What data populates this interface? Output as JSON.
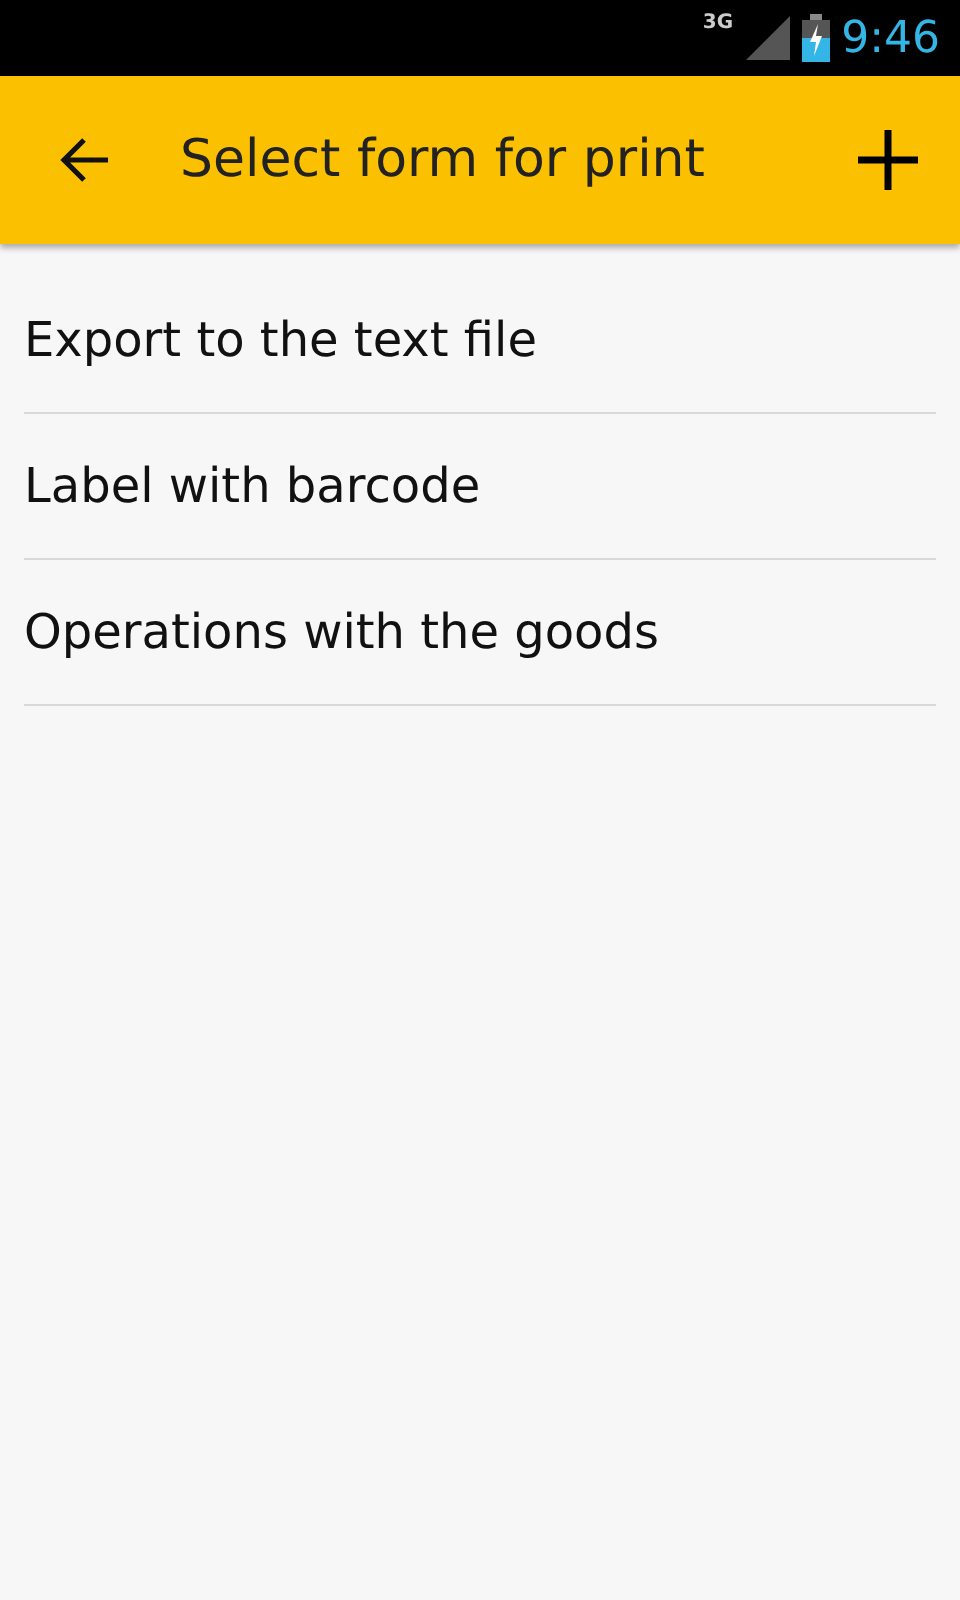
{
  "status_bar": {
    "network": "3G",
    "time": "9:46"
  },
  "toolbar": {
    "title": "Select form for print"
  },
  "items": [
    {
      "label": "Export to the text file"
    },
    {
      "label": "Label with barcode"
    },
    {
      "label": "Operations with the goods"
    }
  ]
}
